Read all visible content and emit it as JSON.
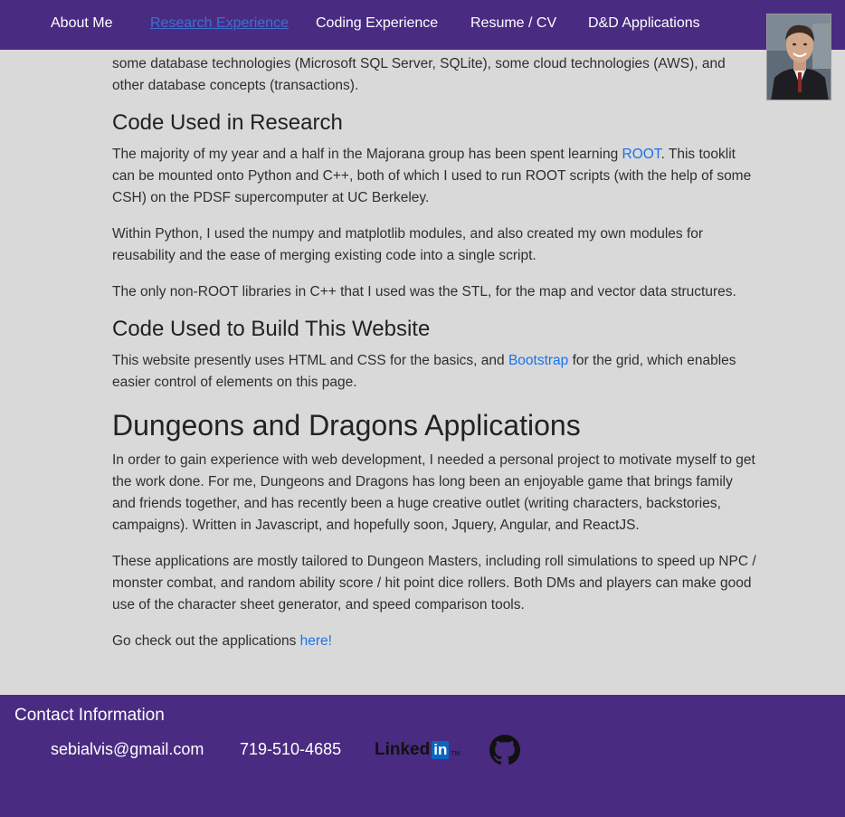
{
  "nav": {
    "items": [
      {
        "label": "About Me"
      },
      {
        "label": "Research Experience"
      },
      {
        "label": "Coding Experience"
      },
      {
        "label": "Resume / CV"
      },
      {
        "label": "D&D Applications"
      }
    ]
  },
  "content": {
    "intro_line1": "some database technologies (Microsoft SQL Server, SQLite), some cloud technologies (AWS), and",
    "intro_line2": "other database concepts (transactions).",
    "research_heading": "Code Used in Research",
    "research_p1_pre": "The majority of my year and a half in the Majorana group has been spent learning ",
    "research_p1_link": "ROOT",
    "research_p1_post": ". This tooklit can be mounted onto Python and C++, both of which I used to run ROOT scripts (with the help of some CSH) on the PDSF supercomputer at UC Berkeley.",
    "research_p2": "Within Python, I used the numpy and matplotlib modules, and also created my own modules for reusability and the ease of merging existing code into a single script.",
    "research_p3": "The only non-ROOT libraries in C++ that I used was the STL, for the map and vector data structures.",
    "website_heading": "Code Used to Build This Website",
    "website_p_pre": "This website presently uses HTML and CSS for the basics, and ",
    "website_p_link": "Bootstrap",
    "website_p_post": " for the grid, which enables easier control of elements on this page.",
    "dnd_heading": "Dungeons and Dragons Applications",
    "dnd_p1": "In order to gain experience with web development, I needed a personal project to motivate myself to get the work done. For me, Dungeons and Dragons has long been an enjoyable game that brings family and friends together, and has recently been a huge creative outlet (writing characters, backstories, campaigns). Written in Javascript, and hopefully soon, Jquery, Angular, and ReactJS.",
    "dnd_p2": "These applications are mostly tailored to Dungeon Masters, including roll simulations to speed up NPC / monster combat, and random ability score / hit point dice rollers. Both DMs and players can make good use of the character sheet generator, and speed comparison tools.",
    "dnd_p3_pre": "Go check out the applications ",
    "dnd_p3_link": "here!"
  },
  "footer": {
    "title": "Contact Information",
    "email": "sebialvis@gmail.com",
    "phone": "719-510-4685",
    "linkedin_text": "Linked",
    "linkedin_box": "in",
    "linkedin_tm": "TM"
  },
  "colors": {
    "nav_bg": "#4a2b82",
    "page_bg": "#d9d9d9",
    "link": "#1a73e8"
  },
  "icons": {
    "github": "github-icon",
    "profile": "profile-photo"
  }
}
